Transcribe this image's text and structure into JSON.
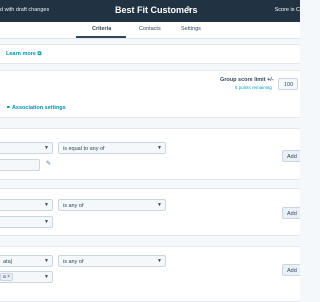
{
  "topbar": {
    "draft_text": "d with draft changes",
    "title": "Best Fit Customers",
    "edit_icon": "pencil-icon",
    "score_text": "Score is C"
  },
  "tabs": [
    {
      "label": "Criteria",
      "active": true
    },
    {
      "label": "Contacts",
      "active": false
    },
    {
      "label": "Settings",
      "active": false
    }
  ],
  "header_section": {
    "learn_more": "Learn more ⧉"
  },
  "group_section": {
    "group_score_label": "Group score limit +/-",
    "points_remaining": "5 points remaining",
    "score_value": "100",
    "association_settings": "Association settings"
  },
  "rules": [
    {
      "property_value": "",
      "operator": "is equal to any of",
      "add_label": "Add"
    },
    {
      "property_value": "",
      "operator": "is any of",
      "add_label": "Add"
    },
    {
      "property_value": "ata)",
      "operator": "is any of",
      "tag_label": "a",
      "tag_close": "×",
      "add_label": "Add"
    }
  ],
  "colors": {
    "topbar_bg": "#213343",
    "link": "#0091ae",
    "panel_bg": "#ffffff",
    "page_bg": "#f5f8fa"
  }
}
